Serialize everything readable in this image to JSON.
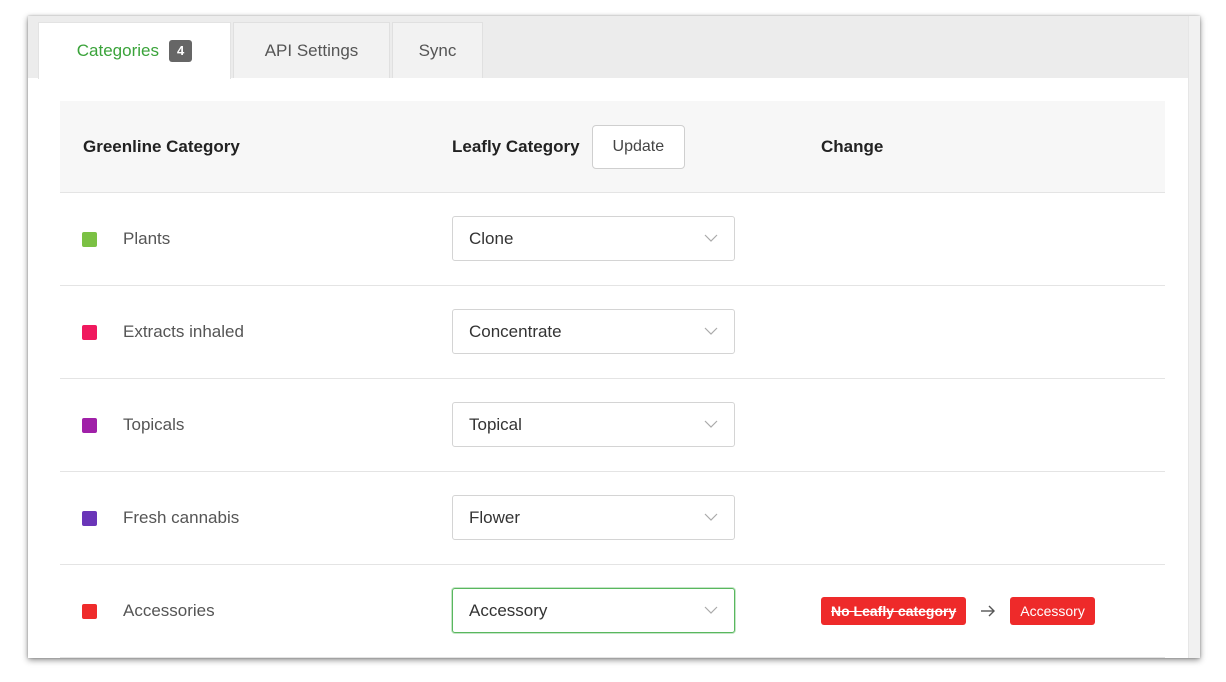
{
  "tabs": [
    {
      "label": "Categories",
      "badge": "4"
    },
    {
      "label": "API Settings"
    },
    {
      "label": "Sync"
    }
  ],
  "table": {
    "headers": {
      "greenline": "Greenline Category",
      "leafly": "Leafly Category",
      "update_button": "Update",
      "change": "Change"
    },
    "rows": [
      {
        "category": "Plants",
        "color": "#7bc144",
        "leafly": "Clone"
      },
      {
        "category": "Extracts inhaled",
        "color": "#f0195e",
        "leafly": "Concentrate"
      },
      {
        "category": "Topicals",
        "color": "#a020a8",
        "leafly": "Topical"
      },
      {
        "category": "Fresh cannabis",
        "color": "#6a35b8",
        "leafly": "Flower"
      },
      {
        "category": "Accessories",
        "color": "#ef2b2b",
        "leafly": "Accessory",
        "change_from": "No Leafly category",
        "change_to": "Accessory"
      }
    ]
  },
  "colors": {
    "accent": "#3aa33a",
    "danger": "#ee2a2a"
  }
}
